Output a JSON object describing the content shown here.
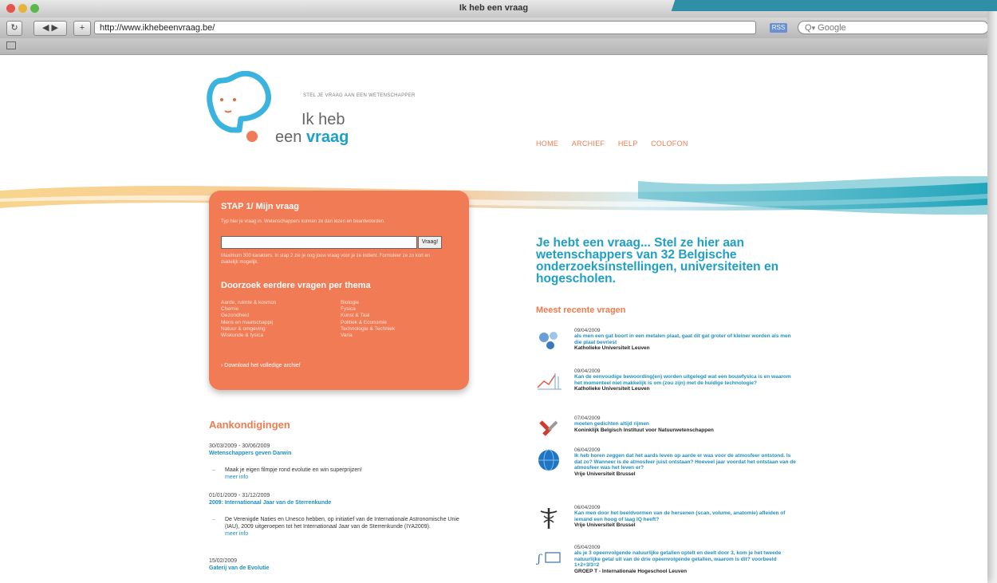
{
  "browser": {
    "window_title": "Ik heb een vraag",
    "address": "http://www.ikhebeenvraag.be/",
    "search_placeholder": "Google",
    "rss": "RSS"
  },
  "logo": {
    "tagline": "STEL JE VRAAG AAN EEN WETENSCHAPPER",
    "line1": "Ik heb",
    "line2_plain": "een ",
    "line2_strong": "vraag"
  },
  "nav": [
    "HOME",
    "ARCHIEF",
    "HELP",
    "COLOFON"
  ],
  "ask": {
    "title": "STAP 1/   Mijn vraag",
    "subtitle": "Typ hier je vraag in. Wetenschappers kunnen ze dan lezen en beantwoorden.",
    "input_value": "",
    "button": "Vraag!",
    "note": "Maximum 300 karakters. In stap 2 zie je nog jouw vraag voor je ze indient. Formuleer ze zo kort en duidelijk mogelijk.",
    "themes_title": "Doorzoek eerdere vragen per thema",
    "themes_col1": [
      "Aarde, ruimte & kosmos",
      "Chemie",
      "Gezondheid",
      "Mens en maatschappij",
      "Natuur & omgeving",
      "Wiskunde & fysica"
    ],
    "themes_col2": [
      "Biologie",
      "Fysica",
      "Kunst & Taal",
      "Politiek & Economie",
      "Technologie & Techniek",
      "Varia"
    ],
    "download": "› Download het volledige archief"
  },
  "announcements": {
    "title": "Aankondigingen",
    "items": [
      {
        "date": "30/03/2009 - 30/06/2009",
        "link": "Wetenschappers geven Darwin",
        "bullet": "Maak je eigen filmpje rond evolutie en win superprijzen!",
        "more": "meer info"
      },
      {
        "date": "01/01/2009 - 31/12/2009",
        "link": "2009: Internationaal Jaar van de Sterrenkunde",
        "bullet": "De Verenigde Naties en Unesco hebben, op initiatief van de Internationale Astronomische Unie (IAU), 2009 uitgeroepen tot het Internationaal Jaar van de Sterrenkunde (IYA2009).",
        "more": "meer info"
      },
      {
        "date": "15/02/2009",
        "link": "Gaterij van de Evolutie",
        "bullet": "",
        "more": ""
      }
    ]
  },
  "headline": "Je hebt een vraag... Stel ze hier aan wetenschappers van 32 Belgische onderzoeksinstellingen, universiteiten en hogescholen.",
  "recent": {
    "title": "Meest recente vragen",
    "items": [
      {
        "icon": "molecule-icon",
        "date": "09/04/2009",
        "title": "als men een gat boort in een metalen plaat, gaat dit gat groter of kleiner worden als men die plaat bevriest",
        "inst": "Katholieke Universiteit Leuven"
      },
      {
        "icon": "chart-icon",
        "date": "09/04/2009",
        "title": "Kan de eenvoudige bewoording(en) worden uitgelegd wat een bouwfysica is en waarom het momenteel niet makkelijk is om (zou zijn) met de huidige technologie?",
        "inst": "Katholieke Universiteit Leuven"
      },
      {
        "icon": "magnet-icon",
        "date": "07/04/2009",
        "title": "moeten gedichten altijd rijmen",
        "inst": "Koninklijk Belgisch Instituut voor Natuurwetenschappen"
      },
      {
        "icon": "globe-icon",
        "date": "06/04/2009",
        "title": "Ik heb horen zeggen dat het aards leven op aarde er was voor de atmosfeer ontstond. Is dat zo? Wanneer is de atmosfeer juist ontstaan? Hoeveel jaar voordat het ontstaan van de atmosfeer was het leven er?",
        "inst": "Vrije Universiteit Brussel"
      },
      {
        "icon": "caduceus-icon",
        "date": "06/04/2009",
        "title": "Kan men door het beeldvormen van de hersenen (scan, volume, anatomie) afleiden of iemand een hoog of laag IQ heeft?",
        "inst": "Vrije Universiteit Brussel"
      },
      {
        "icon": "formula-icon",
        "date": "05/04/2009",
        "title": "als je 3 opeenvolgende natuurlijke getallen optelt en deelt door 3, kom je het tweede natuurlijke getal uit van de drie opeenvolgende getallen, waarom is dit? voorbeeld 1+2+3/3=2",
        "inst": "GROEP T - Internationale Hogeschool Leuven"
      }
    ]
  },
  "colors": {
    "orange": "#f07b55",
    "blue": "#1f9fc6"
  }
}
